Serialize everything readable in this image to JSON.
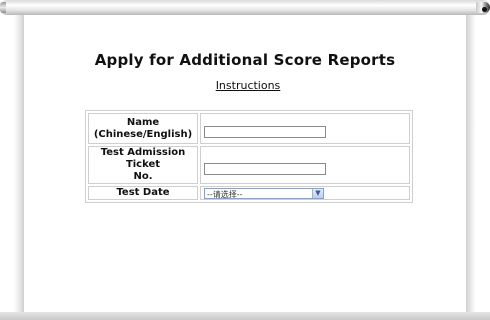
{
  "page": {
    "title": "Apply for Additional Score Reports",
    "instructions_link": "Instructions"
  },
  "form": {
    "name_label_line1": "Name",
    "name_label_line2": "(Chinese/English)",
    "name_value": "",
    "ticket_label_line1": "Test Admission Ticket",
    "ticket_label_line2": "No.",
    "ticket_value": "",
    "date_label": "Test Date",
    "date_selected": "--请选择--"
  },
  "icons": {
    "select_arrow": "chevron-down-icon"
  }
}
